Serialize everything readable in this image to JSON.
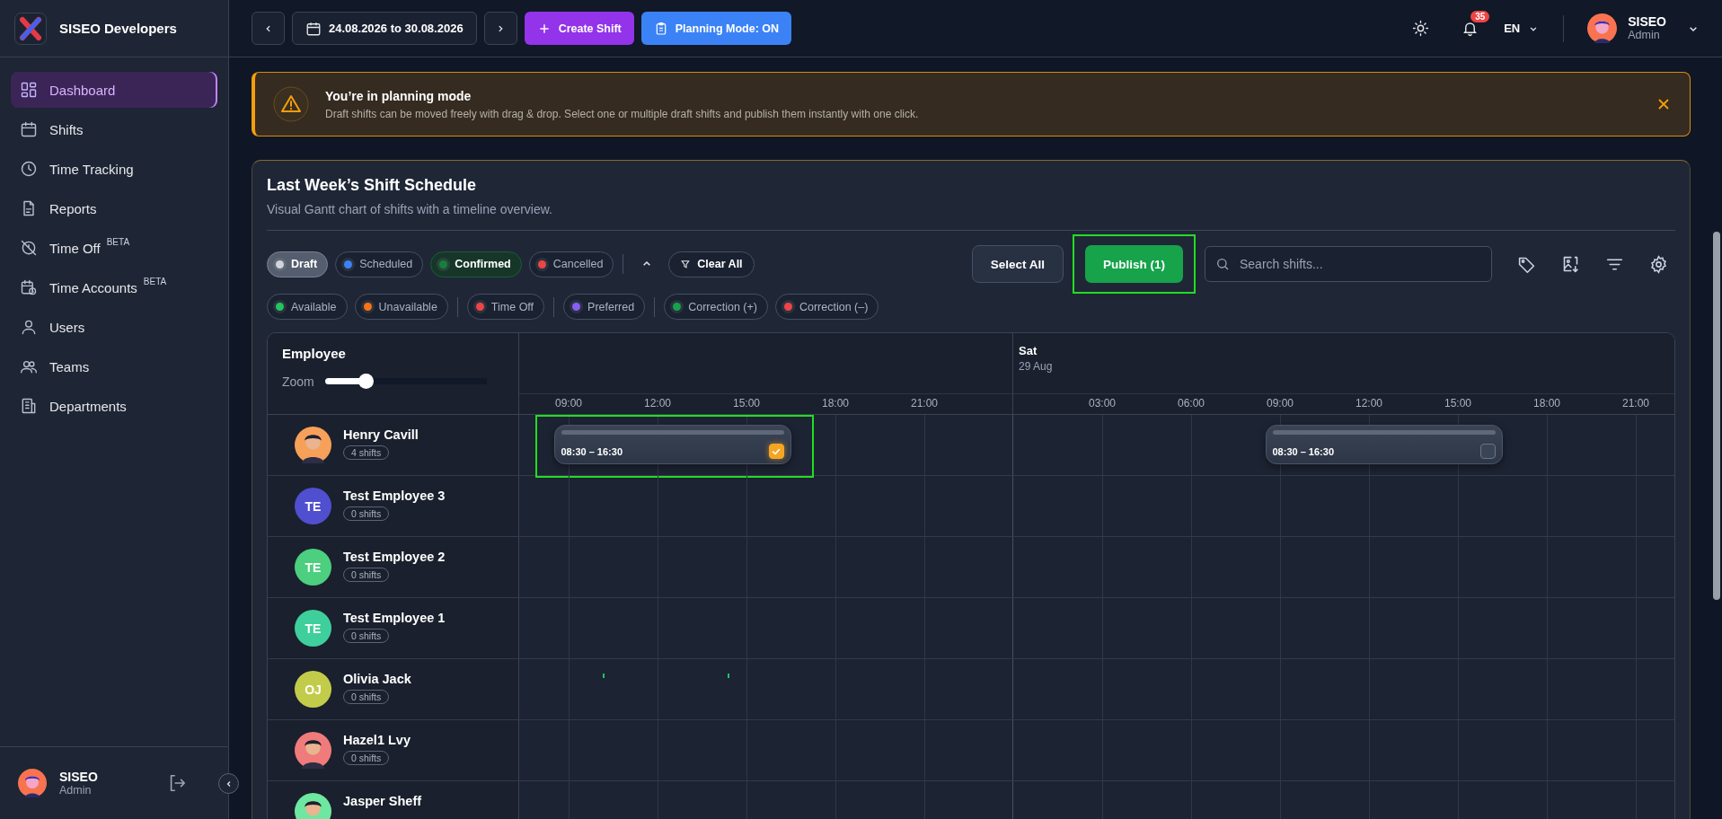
{
  "sidebar": {
    "brand": "SISEO Developers",
    "items": [
      {
        "label": "Dashboard",
        "selected": true
      },
      {
        "label": "Shifts",
        "selected": false
      },
      {
        "label": "Time Tracking",
        "selected": false
      },
      {
        "label": "Reports",
        "selected": false
      },
      {
        "label": "Time Off",
        "badge": "BETA",
        "selected": false
      },
      {
        "label": "Time Accounts",
        "badge": "BETA",
        "selected": false
      },
      {
        "label": "Users",
        "selected": false
      },
      {
        "label": "Teams",
        "selected": false
      },
      {
        "label": "Departments",
        "selected": false
      }
    ],
    "user": {
      "name": "SISEO",
      "role": "Admin"
    }
  },
  "topbar": {
    "date_range": "24.08.2026 to 30.08.2026",
    "create_button": "Create Shift",
    "planning_button": "Planning Mode: ON",
    "notifications": "35",
    "language": "EN",
    "user": {
      "name": "SISEO",
      "role": "Admin"
    }
  },
  "banner": {
    "title": "You’re in planning mode",
    "text": "Draft shifts can be moved freely with drag & drop. Select one or multiple draft shifts and publish them instantly with one click."
  },
  "schedule": {
    "title": "Last Week’s Shift Schedule",
    "subtitle": "Visual Gantt chart of shifts with a timeline overview.",
    "status_filters": [
      {
        "label": "Draft",
        "color": "#d1d5db",
        "selected": true
      },
      {
        "label": "Scheduled",
        "color": "#3b82f6",
        "selected": false
      },
      {
        "label": "Confirmed",
        "color": "#15803d",
        "selected": true
      },
      {
        "label": "Cancelled",
        "color": "#ef4444",
        "selected": false
      }
    ],
    "clear_button": "Clear All",
    "select_all_button": "Select All",
    "publish_button": "Publish (1)",
    "publish_highlighted": true,
    "search": {
      "placeholder": "Search shifts..."
    },
    "type_filter_groups": [
      {
        "filters": [
          {
            "label": "Available",
            "color": "#22c55e"
          },
          {
            "label": "Unavailable",
            "color": "#f97316"
          }
        ]
      },
      {
        "filters": [
          {
            "label": "Time Off",
            "color": "#ef4444"
          }
        ]
      },
      {
        "filters": [
          {
            "label": "Preferred",
            "color": "#8b5cf6"
          }
        ]
      },
      {
        "filters": [
          {
            "label": "Correction (+)",
            "color": "#16a34a"
          },
          {
            "label": "Correction (–)",
            "color": "#ef4444"
          }
        ]
      }
    ],
    "gantt": {
      "employee_header": "Employee",
      "zoom_label": "Zoom",
      "zoom": {
        "level": 0.25
      },
      "days": [
        {
          "ticks": [
            "09:00",
            "12:00",
            "15:00",
            "18:00",
            "21:00"
          ]
        },
        {
          "name": "Sat",
          "date": "29 Aug",
          "ticks": [
            "03:00",
            "06:00",
            "09:00",
            "12:00",
            "15:00",
            "18:00",
            "21:00"
          ]
        }
      ],
      "rows": [
        {
          "name": "Henry Cavill",
          "count": "4 shifts",
          "avatar": {
            "kind": "illustration",
            "color": "#f6a05a"
          },
          "shifts": [
            {
              "time": "08:30 – 16:30",
              "checked": true,
              "highlighted": true
            },
            {
              "time": "08:30 – 16:30",
              "checked": false,
              "highlighted": false
            }
          ]
        },
        {
          "name": "Test Employee 3",
          "count": "0 shifts",
          "avatar": {
            "kind": "initials",
            "initials": "TE",
            "color": "#4f4fcf"
          }
        },
        {
          "name": "Test Employee 2",
          "count": "0 shifts",
          "avatar": {
            "kind": "initials",
            "initials": "TE",
            "color": "#4ccf7f"
          }
        },
        {
          "name": "Test Employee 1",
          "count": "0 shifts",
          "avatar": {
            "kind": "initials",
            "initials": "TE",
            "color": "#3ecf9c"
          }
        },
        {
          "name": "Olivia Jack",
          "count": "0 shifts",
          "avatar": {
            "kind": "initials",
            "initials": "OJ",
            "color": "#c2cc4a"
          },
          "availability_marks": true
        },
        {
          "name": "Hazel1 Lvy",
          "count": "0 shifts",
          "avatar": {
            "kind": "illustration",
            "color": "#f07b7b"
          }
        },
        {
          "name": "Jasper Sheff",
          "avatar": {
            "kind": "illustration",
            "color": "#6ee7a0"
          }
        }
      ]
    }
  }
}
